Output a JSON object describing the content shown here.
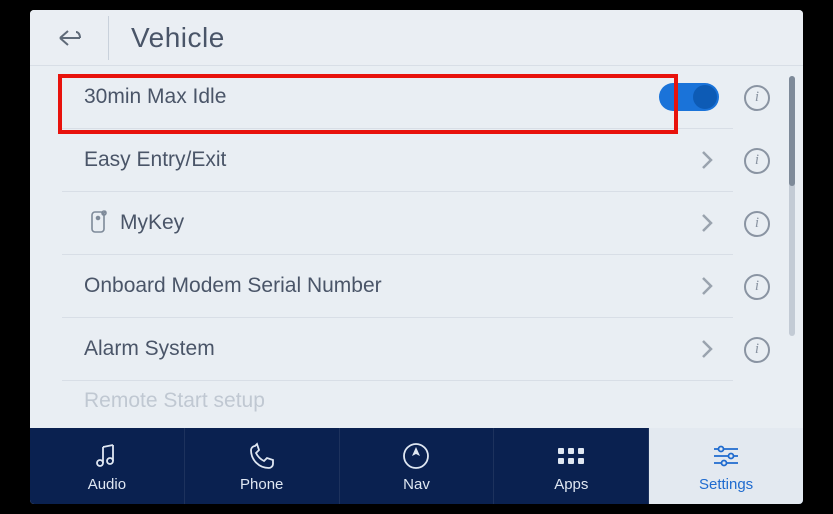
{
  "header": {
    "title": "Vehicle"
  },
  "rows": [
    {
      "label": "30min Max Idle",
      "control": "toggle",
      "enabled": true
    },
    {
      "label": "Easy Entry/Exit",
      "control": "chevron"
    },
    {
      "label": "MyKey",
      "control": "chevron",
      "icon": "mykey"
    },
    {
      "label": "Onboard Modem Serial Number",
      "control": "chevron"
    },
    {
      "label": "Alarm System",
      "control": "chevron"
    },
    {
      "label": "Remote Start setup",
      "control": "chevron",
      "partial": true
    }
  ],
  "nav": [
    {
      "label": "Audio",
      "icon": "audio",
      "active": false
    },
    {
      "label": "Phone",
      "icon": "phone",
      "active": false
    },
    {
      "label": "Nav",
      "icon": "nav",
      "active": false
    },
    {
      "label": "Apps",
      "icon": "apps",
      "active": false
    },
    {
      "label": "Settings",
      "icon": "settings",
      "active": true
    }
  ]
}
